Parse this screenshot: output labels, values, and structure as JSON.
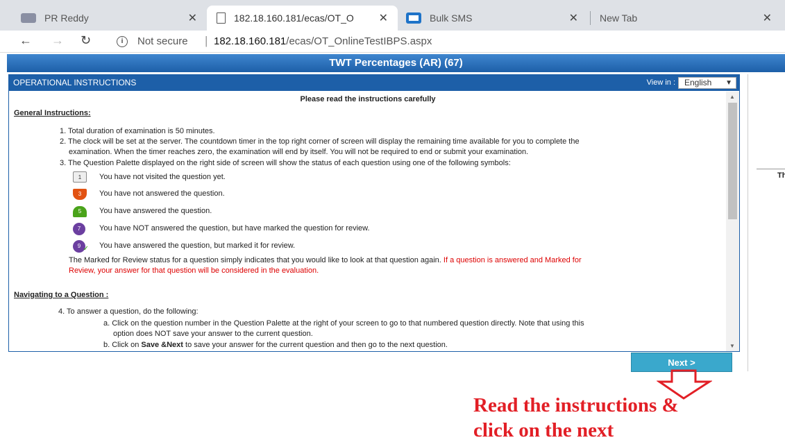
{
  "browser": {
    "tabs": [
      {
        "title": "PR Reddy"
      },
      {
        "title": "182.18.160.181/ecas/OT_O"
      },
      {
        "title": "Bulk SMS"
      },
      {
        "title": "New Tab"
      }
    ],
    "not_secure": "Not secure",
    "url_host": "182.18.160.181",
    "url_path": "/ecas/OT_OnlineTestIBPS.aspx"
  },
  "exam": {
    "title": "TWT Percentages (AR) (67)"
  },
  "panel": {
    "heading": "OPERATIONAL INSTRUCTIONS",
    "view_in": "View in :",
    "language": "English",
    "read_carefully": "Please read the instructions carefully",
    "general_heading": "General Instructions:",
    "g1": "1. Total duration of examination is 50  minutes.",
    "g2a": "2. The clock will be set at the server. The countdown timer in the top right corner of screen will display the remaining time available for you to complete the",
    "g2b": "examination. When the timer reaches zero, the examination will end by itself. You will not be required to end or submit your examination.",
    "g3": "3. The Question Palette displayed on the right side of screen will show the status of each question using one of the following symbols:",
    "symbols": [
      {
        "num": "1",
        "label": "You have not visited the question yet."
      },
      {
        "num": "3",
        "label": "You have not answered the question."
      },
      {
        "num": "5",
        "label": "You have answered the question."
      },
      {
        "num": "7",
        "label": "You have NOT answered the question, but have marked the question for review."
      },
      {
        "num": "9",
        "label": "You have answered the question, but marked it for review."
      }
    ],
    "mark_note_black": "The Marked for Review status for a question simply indicates that you would like to look at that question again.",
    "mark_note_red1": "If a question is answered and Marked for",
    "mark_note_red2": "Review, your answer for that question will be considered in the evaluation.",
    "nav_heading": "Navigating to a Question :",
    "n4": "4. To answer a question, do the following:",
    "n4a1": "a. Click on the question number in the Question Palette at the right of your screen to go to that numbered question directly. Note that using this",
    "n4a2": "option does NOT save your answer to the current question.",
    "n4b_pre": "b. Click on",
    "n4b_bold": "Save &Next",
    "n4b_post": "to save your answer for the current question and then go to the next question."
  },
  "next_label": "Next >",
  "right_panel_letter": "Th",
  "annotation": {
    "line1": "Read the instructions &",
    "line2": "click on the next"
  },
  "colors": {
    "header_blue": "#1d5fa8",
    "next_button": "#3aa8cc",
    "annotation_red": "#e21f26"
  }
}
